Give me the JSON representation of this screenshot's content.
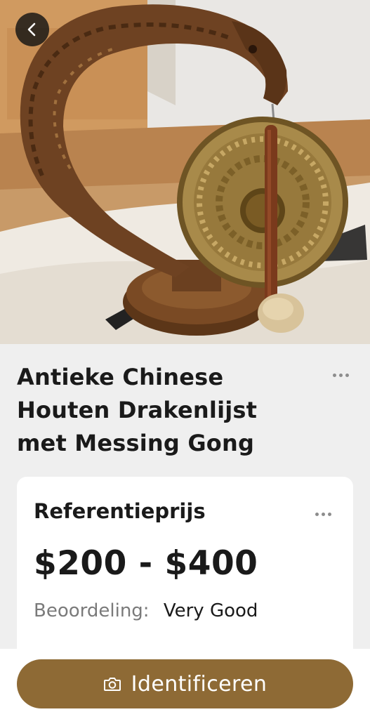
{
  "header": {
    "back_icon": "chevron-left-icon",
    "photo_subject": "carved wooden dragon frame with brass gong and mallet"
  },
  "item": {
    "title": "Antieke Chinese Houten Drakenlijst met Messing Gong",
    "more_icon": "more-horizontal-icon"
  },
  "reference_card": {
    "heading": "Referentieprijs",
    "price_range": "$200 - $400",
    "rating_label": "Beoordeling:",
    "rating_value": "Very Good",
    "more_icon": "more-horizontal-icon"
  },
  "action": {
    "identify_label": "Identificeren",
    "icon": "camera-icon"
  },
  "colors": {
    "accent": "#8e6a35",
    "background": "#efefef",
    "card": "#ffffff",
    "text": "#1a1a1a",
    "muted": "#7a7a7a"
  }
}
